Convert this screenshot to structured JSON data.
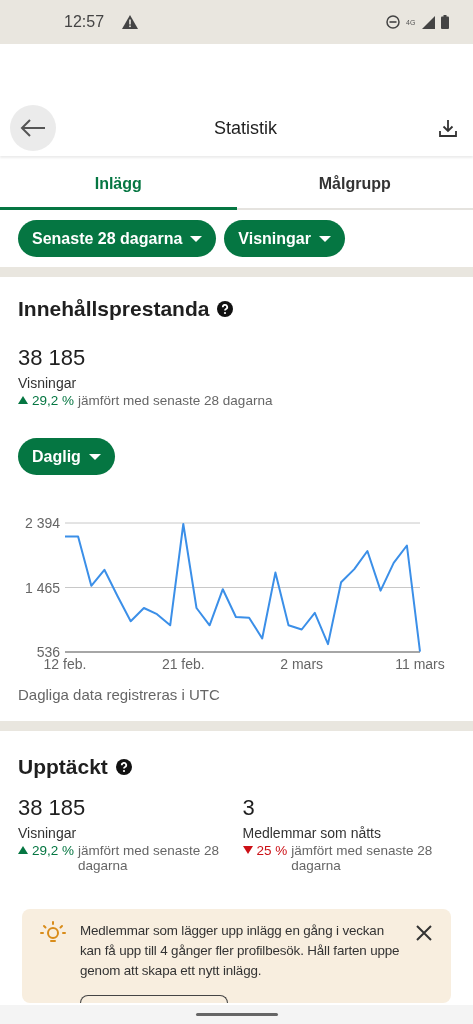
{
  "status_bar": {
    "time": "12:57",
    "network": "4G"
  },
  "app_bar": {
    "title": "Statistik"
  },
  "tabs": [
    {
      "label": "Inlägg",
      "selected": true
    },
    {
      "label": "Målgrupp",
      "selected": false
    }
  ],
  "filters": [
    {
      "label": "Senaste 28 dagarna"
    },
    {
      "label": "Visningar"
    }
  ],
  "performance": {
    "title": "Innehållsprestanda",
    "value": "38 185",
    "metric": "Visningar",
    "change": {
      "increase": true,
      "percent": "29,2 %",
      "text": "jämfört med senaste 28 dagarna"
    },
    "interval": "Daglig",
    "chart_data": {
      "type": "line",
      "categories": [
        "12 feb.",
        null,
        null,
        null,
        null,
        null,
        null,
        null,
        null,
        "21 feb.",
        null,
        null,
        null,
        null,
        null,
        null,
        null,
        null,
        "2 mars",
        null,
        null,
        null,
        null,
        null,
        null,
        null,
        null,
        "11 mars"
      ],
      "values": [
        2200,
        2200,
        1490,
        1720,
        1340,
        980,
        1170,
        1080,
        920,
        2380,
        1170,
        920,
        1440,
        1040,
        1030,
        730,
        1680,
        920,
        860,
        1100,
        650,
        1540,
        1730,
        1990,
        1420,
        1820,
        2070,
        540
      ],
      "ylim": [
        536,
        2394
      ],
      "yticks": [
        {
          "value": 536,
          "label": "536"
        },
        {
          "value": 1465,
          "label": "1 465"
        },
        {
          "value": 2394,
          "label": "2 394"
        }
      ]
    },
    "footnote": "Dagliga data registreras i UTC"
  },
  "discovery": {
    "title": "Upptäckt",
    "stats": [
      {
        "value": "38 185",
        "metric": "Visningar",
        "change": {
          "increase": true,
          "percent": "29,2 %",
          "text": "jämfört med senaste 28 dagarna"
        }
      },
      {
        "value": "3",
        "metric": "Medlemmar som nåtts",
        "change": {
          "increase": false,
          "percent": "25 %",
          "text": "jämfört med senaste 28 dagarna"
        }
      }
    ]
  },
  "tip": {
    "text": "Medlemmar som lägger upp inlägg en gång i veckan kan få upp till 4 gånger fler profilbesök. Håll farten uppe genom att skapa ett nytt inlägg."
  }
}
